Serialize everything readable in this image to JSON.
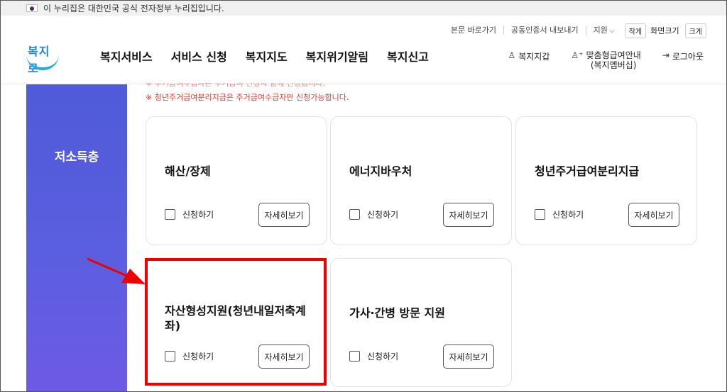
{
  "gov_banner": {
    "text": "이 누리집은 대한민국 공식 전자정부 누리집입니다."
  },
  "utility": {
    "links": [
      "본문 바로가기",
      "공동인증서 내보내기",
      "지원"
    ],
    "font_small": "작게",
    "screen_size": "화면크기",
    "font_large": "크게"
  },
  "logo": {
    "text": "복지로"
  },
  "gnb": [
    "복지서비스",
    "서비스 신청",
    "복지지도",
    "복지위기알림",
    "복지신고"
  ],
  "user_menu": {
    "wallet": "복지지갑",
    "guide_line1": "맞춤형급여안내",
    "guide_line2": "(복지멤버십)",
    "logout": "로그아웃"
  },
  "notices": {
    "cut_text": "※ 주거급여수급자는 주거급여 신청시 함께 신청됩니다.",
    "text": "※ 청년주거급여분리지급은 주거급여수급자만 신청가능합니다."
  },
  "side": {
    "title": "저소득층"
  },
  "cards": [
    {
      "title": "해산/장제",
      "apply": "신청하기",
      "detail": "자세히보기"
    },
    {
      "title": "에너지바우처",
      "apply": "신청하기",
      "detail": "자세히보기"
    },
    {
      "title": "청년주거급여분리지급",
      "apply": "신청하기",
      "detail": "자세히보기"
    },
    {
      "title": "자산형성지원(청년내일저축계좌)",
      "apply": "신청하기",
      "detail": "자세히보기"
    },
    {
      "title": "가사·간병 방문 지원",
      "apply": "신청하기",
      "detail": "자세히보기"
    }
  ],
  "colors": {
    "accent": "#5b5ee0",
    "notice": "#e8382a",
    "highlight": "#ee0000",
    "logo": "#1b86d6"
  }
}
